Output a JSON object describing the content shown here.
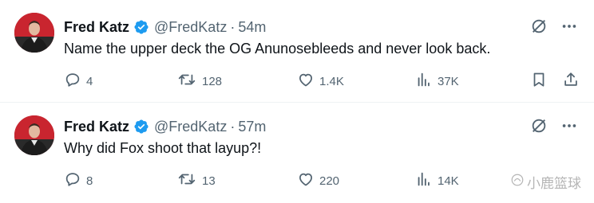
{
  "tweets": [
    {
      "name": "Fred Katz",
      "handle": "@FredKatz",
      "separator": "·",
      "time": "54m",
      "text": "Name the upper deck the OG Anunosebleeds and never look back.",
      "replies": "4",
      "retweets": "128",
      "likes": "1.4K",
      "views": "37K",
      "has_bookmark": true,
      "has_share": true
    },
    {
      "name": "Fred Katz",
      "handle": "@FredKatz",
      "separator": "·",
      "time": "57m",
      "text": "Why did Fox shoot that layup?!",
      "replies": "8",
      "retweets": "13",
      "likes": "220",
      "views": "14K",
      "has_bookmark": false,
      "has_share": false
    }
  ],
  "watermark": {
    "text": "小鹿篮球"
  },
  "colors": {
    "text": "#0f1419",
    "secondary": "#536471",
    "verified": "#1d9bf0",
    "divider": "#eff3f4"
  },
  "icons": [
    "verified-badge-icon",
    "grok-icon",
    "more-icon",
    "reply-icon",
    "retweet-icon",
    "like-icon",
    "views-icon",
    "bookmark-icon",
    "share-icon"
  ]
}
